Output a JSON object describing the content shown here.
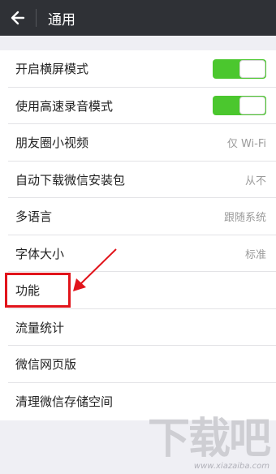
{
  "header": {
    "title": "通用",
    "back_icon": "back-arrow-icon"
  },
  "settings": {
    "landscape": {
      "label": "开启横屏模式",
      "enabled": true
    },
    "fast_record": {
      "label": "使用高速录音模式",
      "enabled": true
    },
    "moments_video": {
      "label": "朋友圈小视频",
      "value": "仅 Wi-Fi"
    },
    "auto_download": {
      "label": "自动下载微信安装包",
      "value": "从不"
    },
    "language": {
      "label": "多语言",
      "value": "跟随系统"
    },
    "font_size": {
      "label": "字体大小",
      "value": "标准"
    },
    "features": {
      "label": "功能"
    },
    "traffic": {
      "label": "流量统计"
    },
    "web_version": {
      "label": "微信网页版"
    },
    "clear_storage": {
      "label": "清理微信存储空间"
    }
  },
  "watermark": {
    "main": "下载吧",
    "sub": "www.xiazaiba.com"
  },
  "colors": {
    "titlebar": "#2f3136",
    "toggle_on": "#4bc72e",
    "annotation": "#e1141b",
    "background": "#efeff4"
  }
}
